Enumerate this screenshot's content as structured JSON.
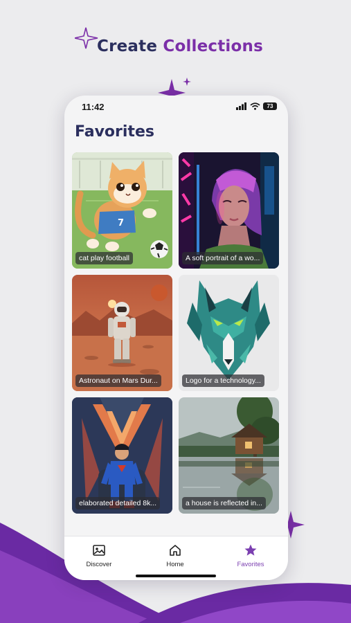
{
  "promo": {
    "headline_part1": "Create",
    "headline_part2": "Collections"
  },
  "status_bar": {
    "time": "11:42",
    "battery": "73"
  },
  "screen": {
    "title": "Favorites"
  },
  "favorites": [
    {
      "caption": "cat play football"
    },
    {
      "caption": "A soft portrait of a wo..."
    },
    {
      "caption": "Astronaut on Mars Dur..."
    },
    {
      "caption": "Logo for a technology..."
    },
    {
      "caption": "elaborated detailed 8k..."
    },
    {
      "caption": "a house is reflected in..."
    }
  ],
  "tabs": [
    {
      "label": "Discover",
      "icon": "image-icon",
      "active": false
    },
    {
      "label": "Home",
      "icon": "home-icon",
      "active": false
    },
    {
      "label": "Favorites",
      "icon": "star-icon",
      "active": true
    }
  ],
  "colors": {
    "title": "#2b2f5e",
    "accent": "#7b2fa8",
    "active_tab": "#7b3fb0",
    "background": "#ececee"
  }
}
